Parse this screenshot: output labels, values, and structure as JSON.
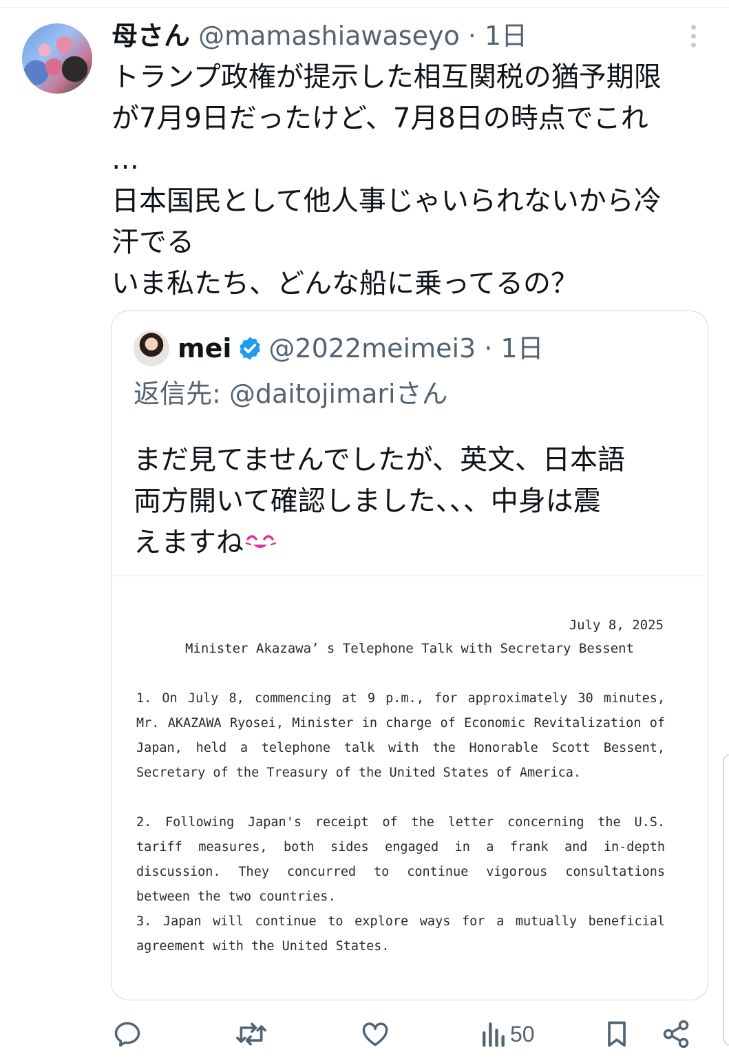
{
  "tweet": {
    "author_name": "母さん",
    "handle_time": " @mamashiawaseyo · 1日",
    "lines": [
      "トランプ政権が提示した相互関税の猶予期限",
      "が7月9日だったけど、7月8日の時点でこれ",
      "…",
      "日本国民として他人事じゃいられないから冷",
      "汗でる",
      "いま私たち、どんな船に乗ってるの？"
    ]
  },
  "quote": {
    "author_name": "mei",
    "handle_time": "@2022meimei3 · 1日",
    "reply_to": "返信先: @daitojimariさん",
    "lines": [
      "まだ見てませんでしたが、英文、日本語",
      "両方開いて確認しました、、、中身は震",
      "えますね"
    ],
    "document": {
      "date": "July 8, 2025",
      "title": "Minister Akazawa’ s Telephone Talk with Secretary Bessent",
      "paragraphs": [
        "1. On July 8, commencing at 9 p.m., for approximately 30 minutes, Mr. AKAZAWA Ryosei, Minister in charge of Economic Revitalization of Japan, held a telephone talk with the Honorable Scott Bessent, Secretary of the Treasury of the United States of America.",
        "2. Following Japan's receipt of the letter concerning the U.S. tariff measures, both sides engaged in a frank and in-depth discussion. They concurred to continue vigorous consultations between the two countries.",
        "3. Japan will continue to explore ways for a mutually beneficial agreement with the United States."
      ]
    }
  },
  "actions": {
    "views_count": "50",
    "icons": [
      "reply-icon",
      "retweet-icon",
      "like-icon",
      "views-icon",
      "bookmark-icon",
      "share-icon"
    ]
  },
  "colors": {
    "text": "#0f1419",
    "secondary": "#536471",
    "verified": "#1d9bf0",
    "emoji": "#e02fa0"
  }
}
